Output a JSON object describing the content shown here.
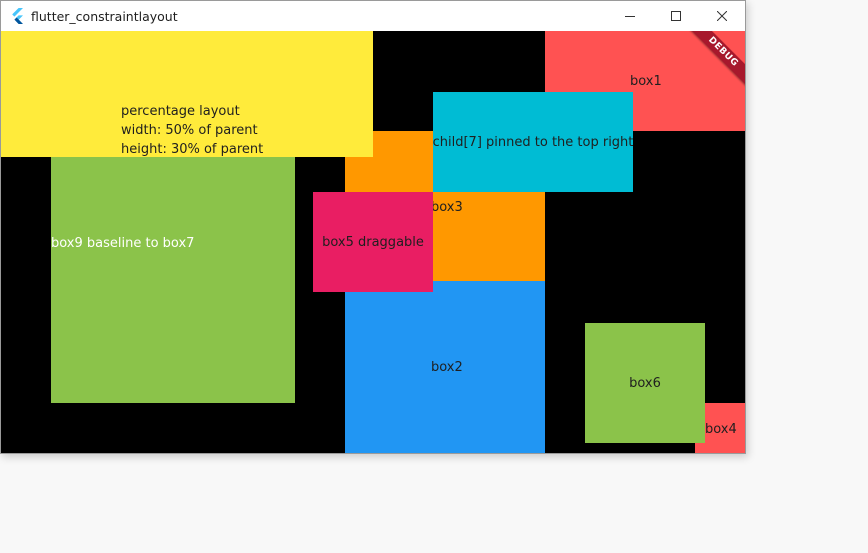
{
  "window": {
    "title": "flutter_constraintlayout",
    "debug_banner": "DEBUG"
  },
  "boxes": {
    "box1": "box1",
    "box2": "box2",
    "box3": "box3",
    "box4": "box4",
    "box5": "box5 draggable",
    "box6": "box6",
    "box9": "box9 baseline to box7",
    "child7": "child[7] pinned to the top right",
    "percentage": "percentage layout\nwidth: 50% of parent\nheight: 30% of parent"
  },
  "colors": {
    "background": "#000000",
    "red": "#ff5252",
    "orange": "#ff9800",
    "blue": "#2196f3",
    "green": "#8bc34a",
    "yellow": "#ffeb3b",
    "cyan": "#00bcd4",
    "pink": "#e91e63"
  },
  "icons": {
    "app": "flutter-logo-icon",
    "minimize": "minimize-icon",
    "maximize": "maximize-icon",
    "close": "close-icon"
  }
}
